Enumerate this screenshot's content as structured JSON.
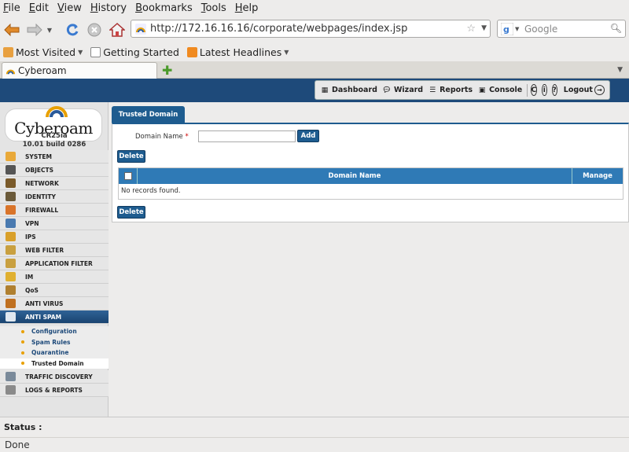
{
  "menubar": {
    "items": [
      "File",
      "Edit",
      "View",
      "History",
      "Bookmarks",
      "Tools",
      "Help"
    ],
    "mnemonics": [
      "F",
      "E",
      "V",
      "H",
      "B",
      "T",
      "H"
    ]
  },
  "browser": {
    "url": "http://172.16.16.16/corporate/webpages/index.jsp",
    "search_placeholder": "Google",
    "bookmarks": [
      "Most Visited",
      "Getting Started",
      "Latest Headlines"
    ],
    "tab_title": "Cyberoam",
    "status": "Done"
  },
  "topnav": {
    "dashboard": "Dashboard",
    "wizard": "Wizard",
    "reports": "Reports",
    "console": "Console",
    "logout": "Logout"
  },
  "sidebar": {
    "logo_text": "Cyberoam",
    "device_model": "CR25ia",
    "device_build": "10.01 build 0286",
    "items": [
      {
        "label": "SYSTEM",
        "icon": "system-icon",
        "color": "#e9a93a"
      },
      {
        "label": "OBJECTS",
        "icon": "objects-icon",
        "color": "#555555"
      },
      {
        "label": "NETWORK",
        "icon": "network-icon",
        "color": "#7a5a2a"
      },
      {
        "label": "IDENTITY",
        "icon": "identity-icon",
        "color": "#6b5a3a"
      },
      {
        "label": "FIREWALL",
        "icon": "firewall-icon",
        "color": "#d9742a"
      },
      {
        "label": "VPN",
        "icon": "vpn-icon",
        "color": "#4a7ab0"
      },
      {
        "label": "IPS",
        "icon": "ips-icon",
        "color": "#d9a02a"
      },
      {
        "label": "WEB FILTER",
        "icon": "web-filter-icon",
        "color": "#c9a040"
      },
      {
        "label": "APPLICATION FILTER",
        "icon": "application-filter-icon",
        "color": "#c9a040"
      },
      {
        "label": "IM",
        "icon": "im-icon",
        "color": "#e0b030"
      },
      {
        "label": "QoS",
        "icon": "qos-icon",
        "color": "#b08030"
      },
      {
        "label": "ANTI VIRUS",
        "icon": "anti-virus-icon",
        "color": "#c07020"
      },
      {
        "label": "ANTI SPAM",
        "icon": "anti-spam-icon",
        "color": "#e0e8f0"
      }
    ],
    "subitems": [
      "Configuration",
      "Spam Rules",
      "Quarantine",
      "Trusted Domain"
    ],
    "items_after": [
      {
        "label": "TRAFFIC DISCOVERY",
        "icon": "traffic-discovery-icon",
        "color": "#7a8a9a"
      },
      {
        "label": "LOGS & REPORTS",
        "icon": "logs-reports-icon",
        "color": "#8a8a8a"
      }
    ]
  },
  "main": {
    "tab_label": "Trusted Domain",
    "domain_label": "Domain Name",
    "required_mark": "*",
    "add_button": "Add",
    "delete_button": "Delete",
    "columns": [
      "Domain Name",
      "Manage"
    ],
    "empty_text": "No records found."
  },
  "status_label": "Status :",
  "colors": {
    "header": "#1e4a7a",
    "button": "#1e5c8f",
    "grid_header": "#2f7ab6",
    "accent": "#e8a000"
  }
}
